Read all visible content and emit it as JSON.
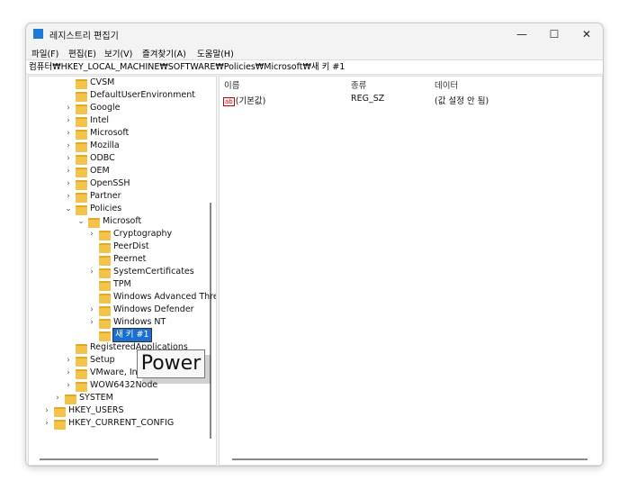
{
  "window": {
    "title": "레지스트리 편집기",
    "minimize": "—",
    "maximize": "☐",
    "close": "✕"
  },
  "menu": [
    "파일(F)",
    "편집(E)",
    "보기(V)",
    "즐겨찾기(A)",
    "도움말(H)"
  ],
  "address": "컴퓨터₩HKEY_LOCAL_MACHINE₩SOFTWARE₩Policies₩Microsoft₩새 키 #1",
  "tree": [
    {
      "label": "CVSM",
      "level": 3,
      "chevron": ""
    },
    {
      "label": "DefaultUserEnvironment",
      "level": 3,
      "chevron": ""
    },
    {
      "label": "Google",
      "level": 3,
      "chevron": ">"
    },
    {
      "label": "Intel",
      "level": 3,
      "chevron": ">"
    },
    {
      "label": "Microsoft",
      "level": 3,
      "chevron": ">"
    },
    {
      "label": "Mozilla",
      "level": 3,
      "chevron": ">"
    },
    {
      "label": "ODBC",
      "level": 3,
      "chevron": ">"
    },
    {
      "label": "OEM",
      "level": 3,
      "chevron": ">"
    },
    {
      "label": "OpenSSH",
      "level": 3,
      "chevron": ">"
    },
    {
      "label": "Partner",
      "level": 3,
      "chevron": ">"
    },
    {
      "label": "Policies",
      "level": 3,
      "chevron": "v"
    },
    {
      "label": "Microsoft",
      "level": 4,
      "chevron": "v"
    },
    {
      "label": "Cryptography",
      "level": 5,
      "chevron": ">"
    },
    {
      "label": "PeerDist",
      "level": 5,
      "chevron": ""
    },
    {
      "label": "Peernet",
      "level": 5,
      "chevron": ""
    },
    {
      "label": "SystemCertificates",
      "level": 5,
      "chevron": ">"
    },
    {
      "label": "TPM",
      "level": 5,
      "chevron": ""
    },
    {
      "label": "Windows Advanced Thre",
      "level": 5,
      "chevron": ""
    },
    {
      "label": "Windows Defender",
      "level": 5,
      "chevron": ">"
    },
    {
      "label": "Windows NT",
      "level": 5,
      "chevron": ">"
    },
    {
      "label": "새 키 #1",
      "level": 5,
      "chevron": "",
      "editing": true
    },
    {
      "label": "RegisteredApplications",
      "level": 3,
      "chevron": ""
    },
    {
      "label": "Setup",
      "level": 3,
      "chevron": ">"
    },
    {
      "label": "VMware, Inc.",
      "level": 3,
      "chevron": ">"
    },
    {
      "label": "WOW6432Node",
      "level": 3,
      "chevron": ">"
    },
    {
      "label": "SYSTEM",
      "level": 2,
      "chevron": ">"
    },
    {
      "label": "HKEY_USERS",
      "level": 1,
      "chevron": ">"
    },
    {
      "label": "HKEY_CURRENT_CONFIG",
      "level": 1,
      "chevron": ">"
    }
  ],
  "tooltip": "Power",
  "values": {
    "headers": [
      "이름",
      "종류",
      "데이터"
    ],
    "rows": [
      {
        "name": "(기본값)",
        "type": "REG_SZ",
        "data": "(값 설정 안 됨)",
        "icon": "ab"
      }
    ]
  }
}
